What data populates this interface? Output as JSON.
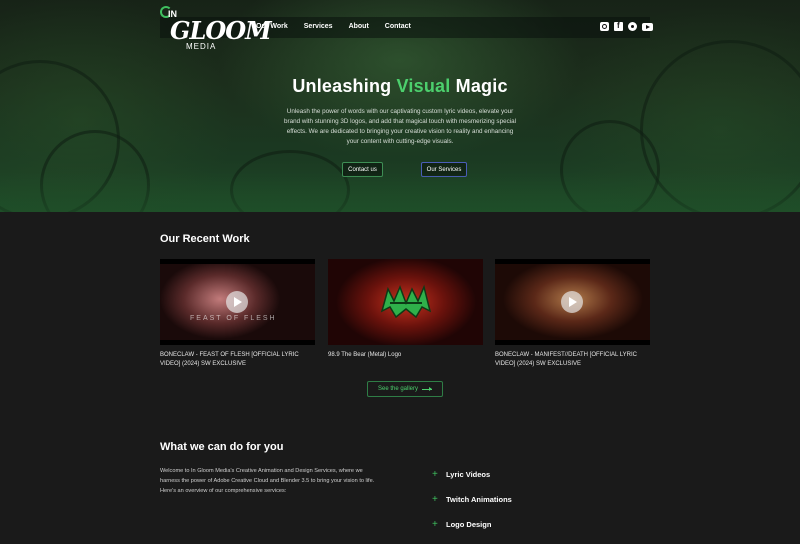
{
  "brand": {
    "in": "IN",
    "name": "GLOOM",
    "sub": "MEDIA"
  },
  "nav": {
    "items": [
      "Our Work",
      "Services",
      "About",
      "Contact"
    ]
  },
  "socials": [
    "instagram-icon",
    "facebook-icon",
    "github-icon",
    "youtube-icon"
  ],
  "hero": {
    "title_pre": "Unleashing ",
    "title_accent": "Visual",
    "title_post": " Magic",
    "description": "Unleash the power of words with our captivating custom lyric videos, elevate your brand with stunning 3D logos, and add that magical touch with mesmerizing special effects. We are dedicated to bringing your creative vision to reality and enhancing your content with cutting-edge visuals.",
    "btn_contact": "Contact us",
    "btn_services": "Our Services"
  },
  "recent": {
    "title": "Our Recent Work",
    "cards": [
      {
        "caption": "BONECLAW - FEAST OF FLESH [OFFICIAL LYRIC VIDEO] (2024) SW EXCLUSIVE",
        "overlay": "FEAST OF FLESH"
      },
      {
        "caption": "98.9 The Bear (Metal) Logo",
        "overlay": ""
      },
      {
        "caption": "BONECLAW - MANIFEST//DEATH [OFFICIAL LYRIC VIDEO] (2024) SW EXCLUSIVE",
        "overlay": ""
      }
    ],
    "gallery_btn": "See the gallery"
  },
  "services": {
    "title": "What we can do for you",
    "intro": "Welcome to In Gloom Media's Creative Animation and Design Services, where we harness the power of Adobe Creative Cloud and Blender 3.5 to bring your vision to life. Here's an overview of our comprehensive services:",
    "items": [
      "Lyric Videos",
      "Twitch Animations",
      "Logo Design"
    ]
  },
  "colors": {
    "accent": "#4ccf6d",
    "bg": "#1a1a1a"
  }
}
